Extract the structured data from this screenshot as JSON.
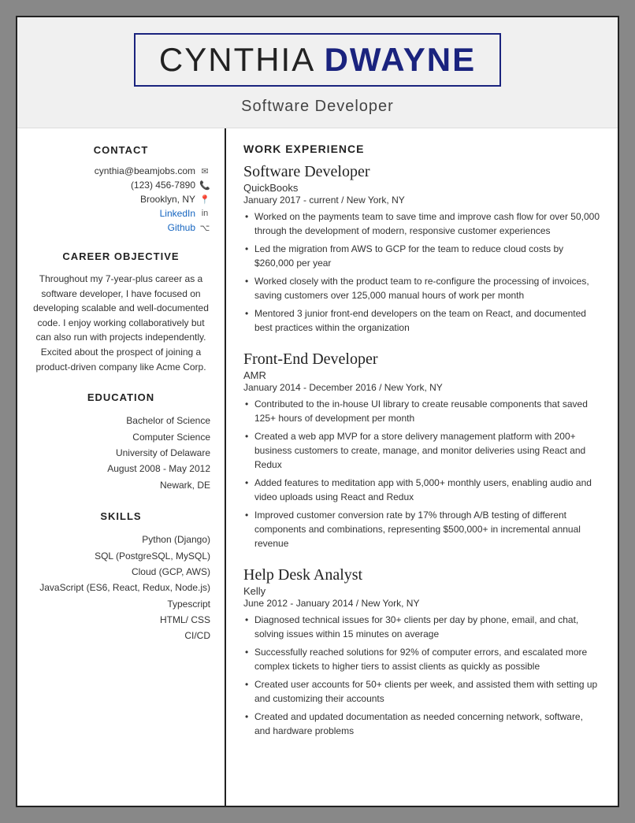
{
  "header": {
    "name_first": "CYNTHIA ",
    "name_last": "DWAYNE",
    "job_title": "Software Developer"
  },
  "sidebar": {
    "contact_title": "CONTACT",
    "contact_email": "cynthia@beamjobs.com",
    "contact_phone": "(123) 456-7890",
    "contact_location": "Brooklyn, NY",
    "contact_linkedin_label": "LinkedIn",
    "contact_github_label": "Github",
    "career_title": "CAREER OBJECTIVE",
    "career_text": "Throughout my 7-year-plus career as a software developer, I have focused on developing scalable and well-documented code. I enjoy working collaboratively but can also run with projects independently. Excited about the prospect of joining a product-driven company like Acme Corp.",
    "education_title": "EDUCATION",
    "degree": "Bachelor of Science",
    "field": "Computer Science",
    "school": "University of Delaware",
    "dates": "August 2008 - May 2012",
    "location": "Newark, DE",
    "skills_title": "SKILLS",
    "skills": [
      "Python (Django)",
      "SQL (PostgreSQL, MySQL)",
      "Cloud (GCP, AWS)",
      "JavaScript (ES6, React, Redux, Node.js)",
      "Typescript",
      "HTML/ CSS",
      "CI/CD"
    ]
  },
  "main": {
    "work_experience_title": "WORK EXPERIENCE",
    "jobs": [
      {
        "title": "Software Developer",
        "company": "QuickBooks",
        "dates": "January 2017 - current  /  New York, NY",
        "bullets": [
          "Worked on the payments team to save time and improve cash flow for over 50,000 through the development of modern, responsive customer experiences",
          "Led the migration from AWS to GCP for the team to reduce cloud costs by $260,000 per year",
          "Worked closely with the product team to re-configure the processing of invoices, saving customers over 125,000 manual hours of work per month",
          "Mentored 3 junior front-end developers on the team on React, and documented best practices within the organization"
        ]
      },
      {
        "title": "Front-End Developer",
        "company": "AMR",
        "dates": "January 2014 - December 2016  /  New York, NY",
        "bullets": [
          "Contributed to the in-house UI library to create reusable components that saved 125+ hours of development per month",
          "Created a web app MVP for a store delivery management platform with 200+ business customers to create, manage, and monitor deliveries using React and Redux",
          "Added features to meditation app with 5,000+ monthly users, enabling audio and video uploads using React and Redux",
          "Improved customer conversion rate by 17% through A/B testing of different components and combinations, representing $500,000+ in incremental annual revenue"
        ]
      },
      {
        "title": "Help Desk Analyst",
        "company": "Kelly",
        "dates": "June 2012 - January 2014  /  New York, NY",
        "bullets": [
          "Diagnosed technical issues for 30+ clients per day by phone, email, and chat, solving issues within 15 minutes on average",
          "Successfully reached solutions for 92% of computer errors, and escalated more complex tickets to higher tiers to assist clients as quickly as possible",
          "Created user accounts for 50+ clients per week, and assisted them with setting up and customizing their accounts",
          "Created and updated documentation as needed concerning network, software, and hardware problems"
        ]
      }
    ]
  }
}
